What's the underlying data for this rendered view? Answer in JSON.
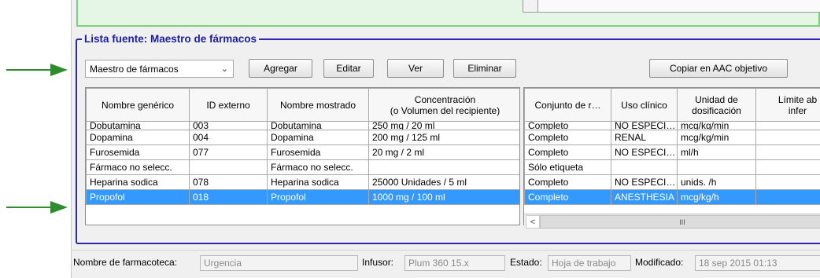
{
  "group": {
    "title": "Lista fuente: Maestro de fármacos"
  },
  "toolbar": {
    "source_select_value": "Maestro de fármacos",
    "add_label": "Agregar",
    "edit_label": "Editar",
    "view_label": "Ver",
    "delete_label": "Eliminar",
    "copy_label": "Copiar en AAC objetivo"
  },
  "left_table": {
    "headers": [
      "Nombre genérico",
      "ID externo",
      "Nombre mostrado",
      "Concentración",
      "(o Volumen del recipiente)"
    ],
    "rows": [
      [
        "Dobutamina",
        "003",
        "Dobutamina",
        "250 mg / 20 ml"
      ],
      [
        "Dopamina",
        "004",
        "Dopamina",
        "200 mg / 125 ml"
      ],
      [
        "Furosemida",
        "077",
        "Furosemida",
        "20 mg / 2 ml"
      ],
      [
        "Fármaco no selecc.",
        "",
        "Fármaco no selecc.",
        ""
      ],
      [
        "Heparina sodica",
        "078",
        "Heparina sodica",
        "25000 Unidades / 5 ml"
      ],
      [
        "Propofol",
        "018",
        "Propofol",
        "1000 mg / 100 ml"
      ]
    ]
  },
  "right_table": {
    "headers": [
      "Conjunto de r…",
      "Uso clínico",
      "Unidad de",
      "dosificación",
      "Límite ab",
      "infer"
    ],
    "rows": [
      [
        "Completo",
        "NO ESPECI…",
        "mcg/kg/min",
        ""
      ],
      [
        "Completo",
        "RENAL",
        "mcg/kg/min",
        ""
      ],
      [
        "Completo",
        "NO ESPECI…",
        "ml/h",
        ""
      ],
      [
        "Sólo etiqueta",
        "",
        "",
        ""
      ],
      [
        "Completo",
        "NO ESPECI…",
        "unids. /h",
        ""
      ],
      [
        "Completo",
        "ANESTHESIA",
        "mcg/kg/h",
        ""
      ]
    ],
    "scroll_left": "<",
    "scroll_thumb": "III"
  },
  "status": {
    "library_label": "Nombre de farmacoteca:",
    "library_value": "Urgencia",
    "infuser_label": "Infusor:",
    "infuser_value": "Plum 360 15.x",
    "state_label": "Estado:",
    "state_value": "Hoja de trabajo",
    "modified_label": "Modificado:",
    "modified_value": "18 sep 2015 01:13"
  },
  "colors": {
    "accent": "#2a2ab0",
    "selection": "#3399ff",
    "arrow": "#2e8b2e",
    "top_panel_border": "#7bd27b"
  },
  "icons": {
    "dropdown": "chevron-down-icon",
    "scroll_left": "scroll-left-arrow-icon",
    "annotation": "green-arrow-icon"
  }
}
